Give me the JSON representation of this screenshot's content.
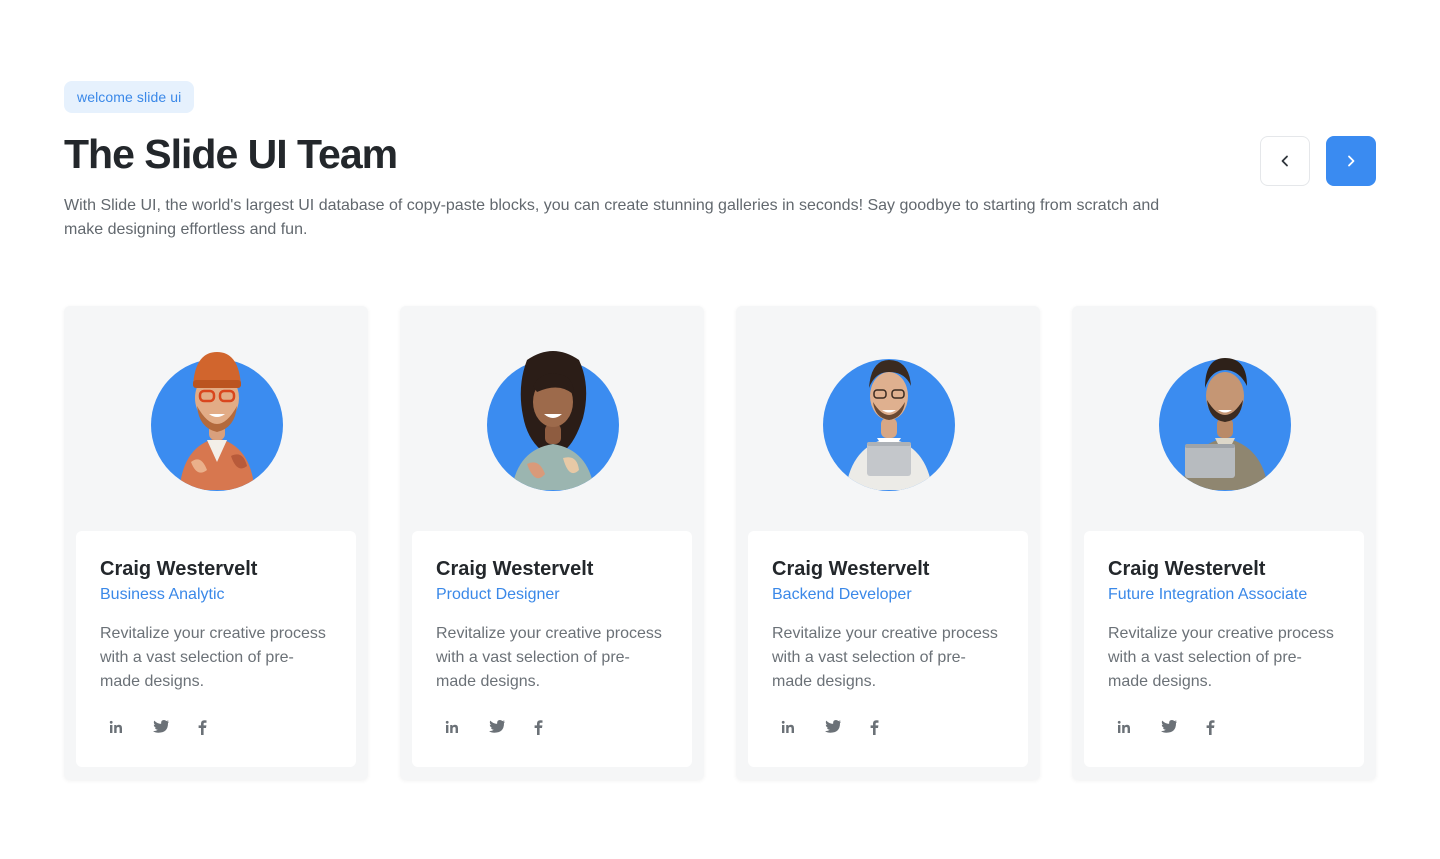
{
  "badge": "welcome slide ui",
  "title": "The Slide UI Team",
  "intro": "With Slide UI, the world's largest UI database of copy-paste blocks, you can create stunning galleries in seconds! Say goodbye to starting from scratch and make designing effortless and fun.",
  "nav": {
    "prev_icon": "chevron-left-icon",
    "next_icon": "chevron-right-icon",
    "accent": "#3a8bf1"
  },
  "colors": {
    "accent": "#3a88e8",
    "avatar_bg": "#3b8cf0",
    "card_bg": "#f5f6f7"
  },
  "members": [
    {
      "name": "Craig Westervelt",
      "role": "Business Analytic",
      "description": "Revitalize your creative process with a vast selection of pre-made designs.",
      "avatar": "man-orange-beanie-avatar",
      "socials": [
        "linkedin-icon",
        "twitter-icon",
        "facebook-icon"
      ]
    },
    {
      "name": "Craig Westervelt",
      "role": "Product Designer",
      "description": "Revitalize your creative process with a vast selection of pre-made designs.",
      "avatar": "woman-curly-hair-avatar",
      "socials": [
        "linkedin-icon",
        "twitter-icon",
        "facebook-icon"
      ]
    },
    {
      "name": "Craig Westervelt",
      "role": "Backend Developer",
      "description": "Revitalize your creative process with a vast selection of pre-made designs.",
      "avatar": "man-laptop-white-shirt-avatar",
      "socials": [
        "linkedin-icon",
        "twitter-icon",
        "facebook-icon"
      ]
    },
    {
      "name": "Craig Westervelt",
      "role": "Future Integration Associate",
      "description": "Revitalize your creative process with a vast selection of pre-made designs.",
      "avatar": "man-laptop-jacket-avatar",
      "socials": [
        "linkedin-icon",
        "twitter-icon",
        "facebook-icon"
      ]
    }
  ]
}
